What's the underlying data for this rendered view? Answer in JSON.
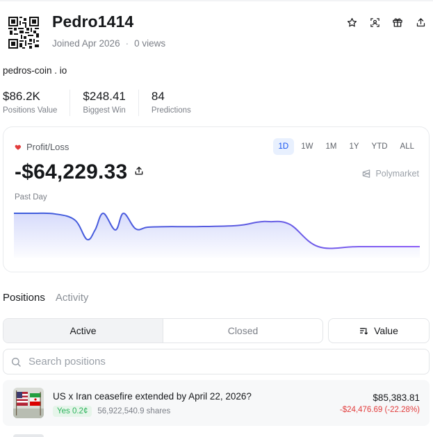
{
  "profile": {
    "username": "Pedro1414",
    "joined": "Joined Apr 2026",
    "separator": "·",
    "views": "0 views",
    "bio": "pedros-coin . io"
  },
  "header_icons": [
    "star-icon",
    "scan-face-icon",
    "gift-icon",
    "share-icon"
  ],
  "stats": [
    {
      "value": "$86.2K",
      "label": "Positions Value"
    },
    {
      "value": "$248.41",
      "label": "Biggest Win"
    },
    {
      "value": "84",
      "label": "Predictions"
    }
  ],
  "pnl": {
    "label": "Profit/Loss",
    "value": "-$64,229.33",
    "period": "Past Day",
    "brand": "Polymarket",
    "ranges": [
      "1D",
      "1W",
      "1M",
      "1Y",
      "YTD",
      "ALL"
    ],
    "active_range": "1D",
    "accent_color": "#1452f0",
    "heart_color": "#e23b3b"
  },
  "chart_data": {
    "type": "area",
    "title": "",
    "xlabel": "",
    "ylabel": "",
    "x": [
      0,
      5,
      10,
      15,
      18,
      20,
      22,
      25,
      27,
      30,
      33,
      38,
      45,
      55,
      60,
      63,
      68,
      75,
      85,
      100
    ],
    "values": [
      0,
      0,
      -1,
      -12,
      -47,
      -30,
      0,
      -30,
      0,
      -28,
      -25,
      -24,
      -24,
      -22,
      -16,
      -15,
      -20,
      -60,
      -60,
      -60
    ],
    "gradient_colors": [
      "#3b5bdb",
      "#8b5cf6"
    ]
  },
  "tabs": [
    {
      "label": "Positions",
      "active": true
    },
    {
      "label": "Activity",
      "active": false
    }
  ],
  "filters": {
    "active": "Active",
    "closed": "Closed",
    "sort": "Value"
  },
  "search": {
    "placeholder": "Search positions"
  },
  "positions": [
    {
      "title": "US x Iran ceasefire extended by April 22, 2026?",
      "outcome": "Yes 0.2¢",
      "shares": "56,922,540.9 shares",
      "value": "$85,383.81",
      "change": "-$24,476.69 (-22.28%)"
    }
  ]
}
